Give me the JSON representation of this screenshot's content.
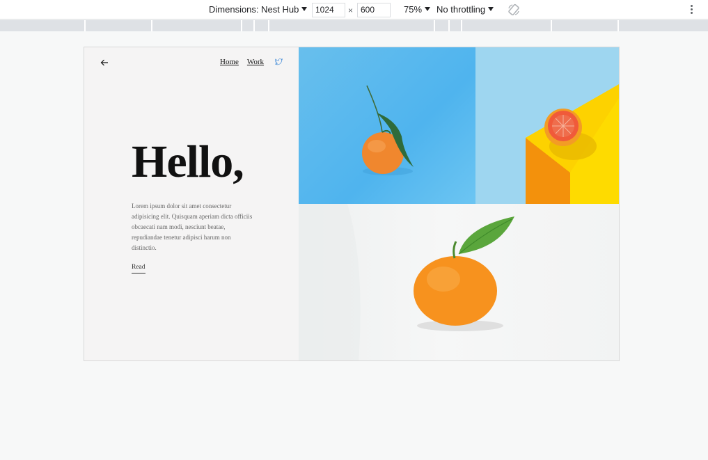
{
  "devtools": {
    "dimensions_label": "Dimensions: Nest Hub",
    "width_value": "1024",
    "times": "×",
    "height_value": "600",
    "zoom": "75%",
    "throttling": "No throttling"
  },
  "site": {
    "nav": {
      "home": "Home",
      "work": "Work"
    },
    "heading": "Hello,",
    "body_text": "Lorem ipsum dolor sit amet consectetur adipisicing elit. Quisquam aperiam dicta officiis obcaecati nam modi, nesciunt beatae, repudiandae tenetur adipisci harum non distinctio.",
    "read_link": "Read"
  },
  "colors": {
    "twitter": "#4a90d9",
    "page_bg": "#f5f4f4"
  },
  "icons": {
    "back": "left-arrow-icon",
    "twitter": "twitter-icon",
    "rotate": "rotate-icon",
    "more": "kebab-menu-icon"
  }
}
